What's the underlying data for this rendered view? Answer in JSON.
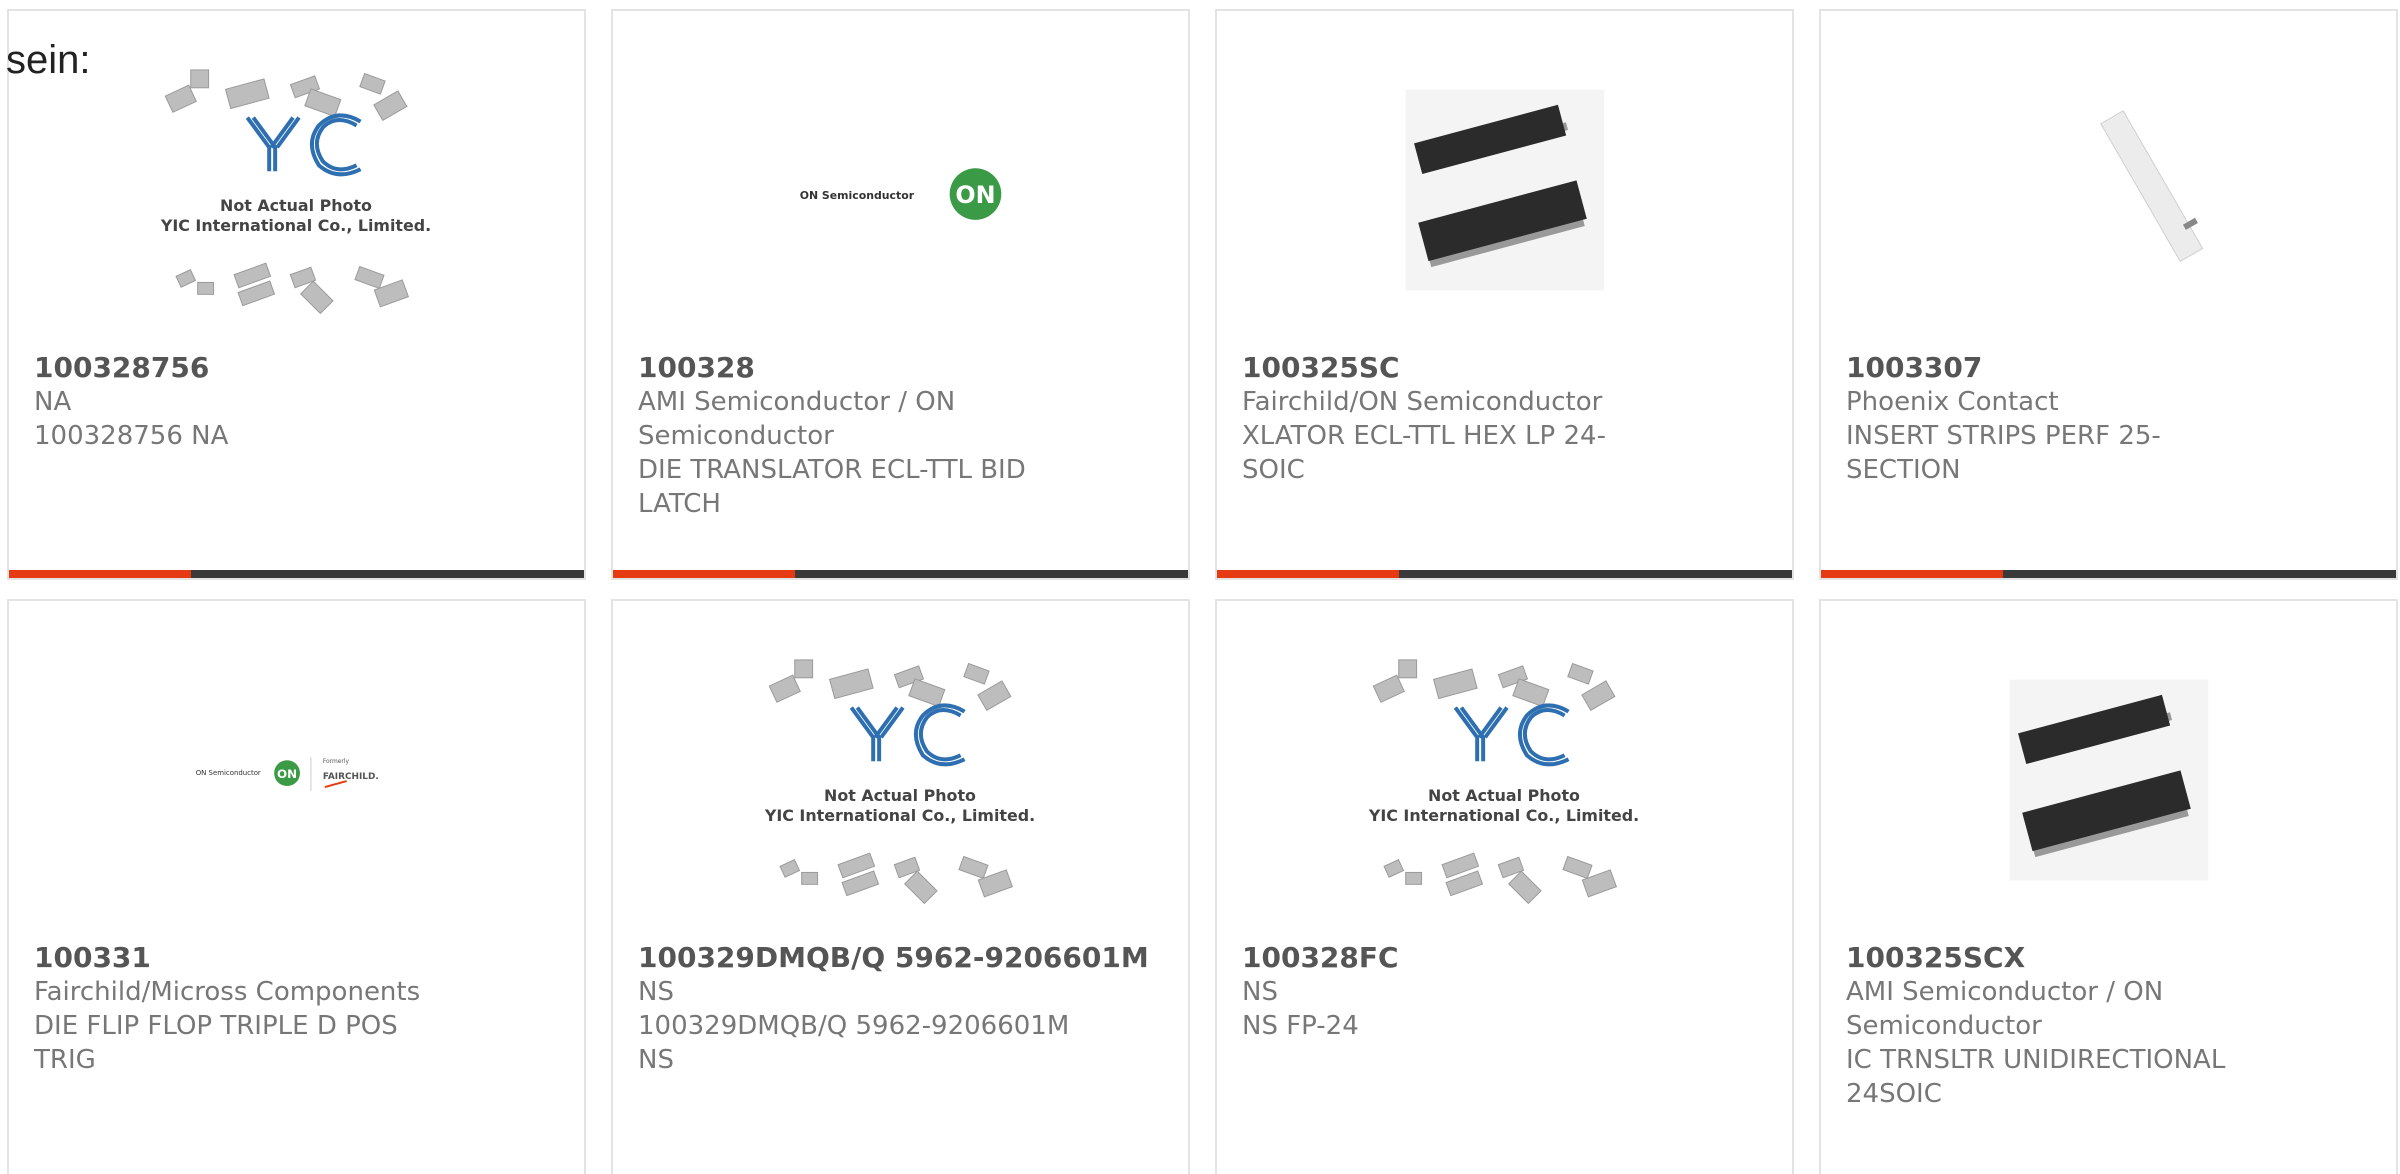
{
  "intro_text": "sein:",
  "placeholder_image": {
    "caption_1": "Not Actual Photo",
    "caption_2": "YIC International Co., Limited."
  },
  "logos": {
    "on_text": "ON Semiconductor",
    "on_badge": "ON",
    "formerly": "Formerly",
    "fairchild": "FAIRCHILD."
  },
  "colors": {
    "accent": "#e53a12",
    "bar": "#3a3a3a",
    "on_green": "#3b9a45",
    "yic_blue": "#2d6fb0"
  },
  "products": [
    {
      "part": "100328756",
      "lines": [
        "NA",
        "100328756 NA"
      ],
      "image": "yic-placeholder"
    },
    {
      "part": "100328",
      "lines": [
        "AMI Semiconductor / ON",
        "Semiconductor",
        "DIE TRANSLATOR ECL-TTL BID",
        "LATCH"
      ],
      "image": "on-logo"
    },
    {
      "part": "100325SC",
      "lines": [
        "Fairchild/ON Semiconductor",
        "XLATOR ECL-TTL HEX LP 24-SOIC"
      ],
      "image": "soic-chip"
    },
    {
      "part": "1003307",
      "lines": [
        "Phoenix Contact",
        "INSERT STRIPS PERF 25-",
        "SECTION"
      ],
      "image": "strip"
    },
    {
      "part": "100331",
      "lines": [
        "Fairchild/Micross Components",
        "DIE FLIP FLOP TRIPLE D POS",
        "TRIG"
      ],
      "image": "on-fairchild-logo"
    },
    {
      "part": "100329DMQB/Q 5962-9206601M",
      "lines": [
        "NS",
        "100329DMQB/Q 5962-9206601M",
        "NS"
      ],
      "image": "yic-placeholder"
    },
    {
      "part": "100328FC",
      "lines": [
        "NS",
        "NS FP-24"
      ],
      "image": "yic-placeholder"
    },
    {
      "part": "100325SCX",
      "lines": [
        "AMI Semiconductor / ON",
        "Semiconductor",
        "IC TRNSLTR UNIDIRECTIONAL",
        "24SOIC"
      ],
      "image": "soic-chip"
    }
  ]
}
